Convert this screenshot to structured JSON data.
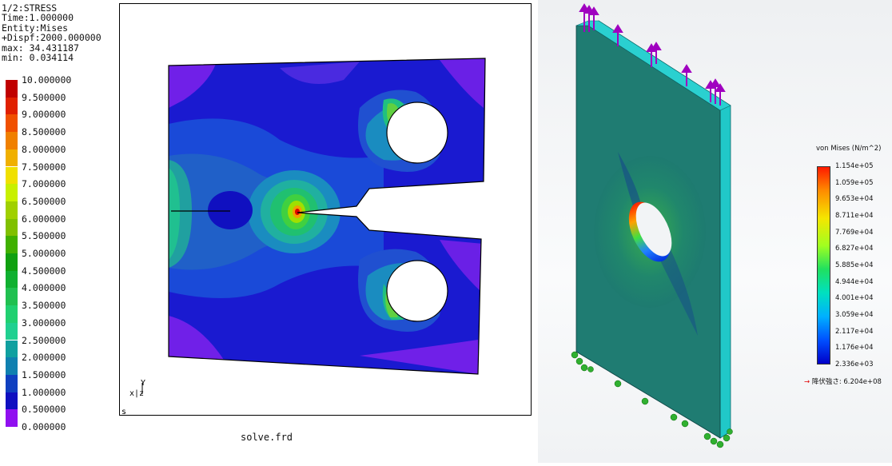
{
  "left_plot": {
    "info_lines": [
      "1/2:STRESS",
      "Time:1.000000",
      "Entity:Mises",
      "+Dispf:2000.000000",
      "max: 34.431187",
      "min: 0.034114"
    ],
    "legend": [
      {
        "label": "10.000000",
        "color": "#c00000"
      },
      {
        "label": "9.500000",
        "color": "#e02000"
      },
      {
        "label": "9.000000",
        "color": "#f05000"
      },
      {
        "label": "8.500000",
        "color": "#f08000"
      },
      {
        "label": "8.000000",
        "color": "#f0b000"
      },
      {
        "label": "7.500000",
        "color": "#f0e000"
      },
      {
        "label": "7.000000",
        "color": "#c8f000"
      },
      {
        "label": "6.500000",
        "color": "#a0d000"
      },
      {
        "label": "6.000000",
        "color": "#80c000"
      },
      {
        "label": "5.500000",
        "color": "#40b000"
      },
      {
        "label": "5.000000",
        "color": "#10a010"
      },
      {
        "label": "4.500000",
        "color": "#10b030"
      },
      {
        "label": "4.000000",
        "color": "#20c050"
      },
      {
        "label": "3.500000",
        "color": "#20d070"
      },
      {
        "label": "3.000000",
        "color": "#20d090"
      },
      {
        "label": "2.500000",
        "color": "#10a0a0"
      },
      {
        "label": "2.000000",
        "color": "#1080b0"
      },
      {
        "label": "1.500000",
        "color": "#1040c0"
      },
      {
        "label": "1.000000",
        "color": "#1010c0"
      },
      {
        "label": "0.500000",
        "color": "#6010e0"
      },
      {
        "label": "0.000000",
        "color": "#9010f0"
      }
    ],
    "axis_y": "Y",
    "axis_xz": "x|z",
    "corner_mark": "s",
    "footer": "solve.frd"
  },
  "right_plot": {
    "title": "von Mises (N/m^2)",
    "legend_labels": [
      "1.154e+05",
      "1.059e+05",
      "9.653e+04",
      "8.711e+04",
      "7.769e+04",
      "6.827e+04",
      "5.885e+04",
      "4.944e+04",
      "4.001e+04",
      "3.059e+04",
      "2.117e+04",
      "1.176e+04",
      "2.336e+03"
    ],
    "yield_text": "降伏強さ: 6.204e+08",
    "yield_arrow": "→"
  }
}
